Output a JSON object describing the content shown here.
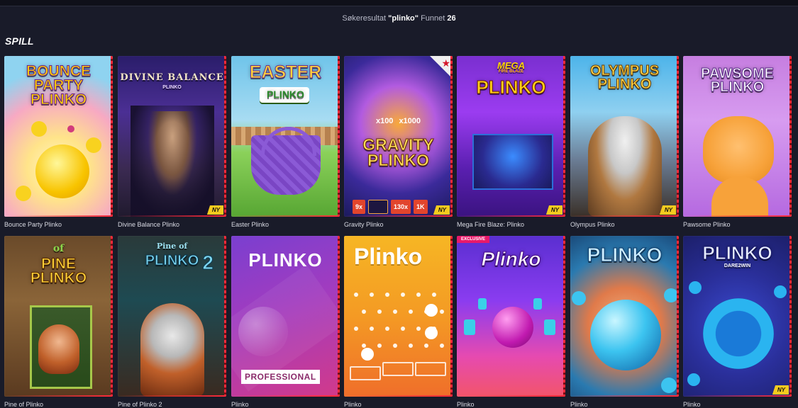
{
  "header": {
    "results_prefix": "Søkeresultat",
    "query": "\"plinko\"",
    "found_label": "Funnet",
    "count": "26"
  },
  "section": {
    "title": "SPILL"
  },
  "games": [
    {
      "name": "Bounce Party Plinko",
      "logo": "BOUNCE\nPARTY\nPLINKO",
      "new": false
    },
    {
      "name": "Divine Balance Plinko",
      "logo": "DIVINE BALANCE",
      "sublogo": "PLINKO",
      "new": true
    },
    {
      "name": "Easter Plinko",
      "logo": "EASTER",
      "sublogo": "PLINKO",
      "new": false
    },
    {
      "name": "Gravity Plinko",
      "logo": "GRAVITY\nPLINKO",
      "top_mults": [
        "x100",
        "x1000"
      ],
      "bottom_mults": [
        "9x",
        "130x",
        "1K"
      ],
      "new": true
    },
    {
      "name": "Mega Fire Blaze: Plinko",
      "logo": "PLINKO",
      "sublogo": "MEGA",
      "tagline": "FIRE BLAZE",
      "new": true
    },
    {
      "name": "Olympus Plinko",
      "logo": "OLYMPUS\nPLINKO",
      "new": true
    },
    {
      "name": "Pawsome Plinko",
      "logo": "PAWSOME\nPLINKO",
      "new": false
    },
    {
      "name": "Pine of Plinko",
      "logo": "PINE\nPLINKO",
      "sublogo": "of",
      "new": false
    },
    {
      "name": "Pine of Plinko 2",
      "logo": "PLINKO",
      "sublogo": "Pine of",
      "extra": "2",
      "new": false
    },
    {
      "name": "Plinko",
      "logo": "PLINKO",
      "bottom_label": "PROFESSIONAL",
      "new": false
    },
    {
      "name": "Plinko",
      "logo": "Plinko",
      "new": false
    },
    {
      "name": "Plinko",
      "logo": "Plinko",
      "tag": "EXCLUSIVE",
      "new": false
    },
    {
      "name": "Plinko",
      "logo": "PLINKO",
      "new": false
    },
    {
      "name": "Plinko",
      "logo": "PLINKO",
      "sublogo": "DARE2WIN",
      "new": true
    }
  ],
  "badge_new_label": "NY",
  "colors": {
    "background": "#191b29",
    "new_badge": "#f5cb1f",
    "tile_edge": "#ff2a3a"
  }
}
